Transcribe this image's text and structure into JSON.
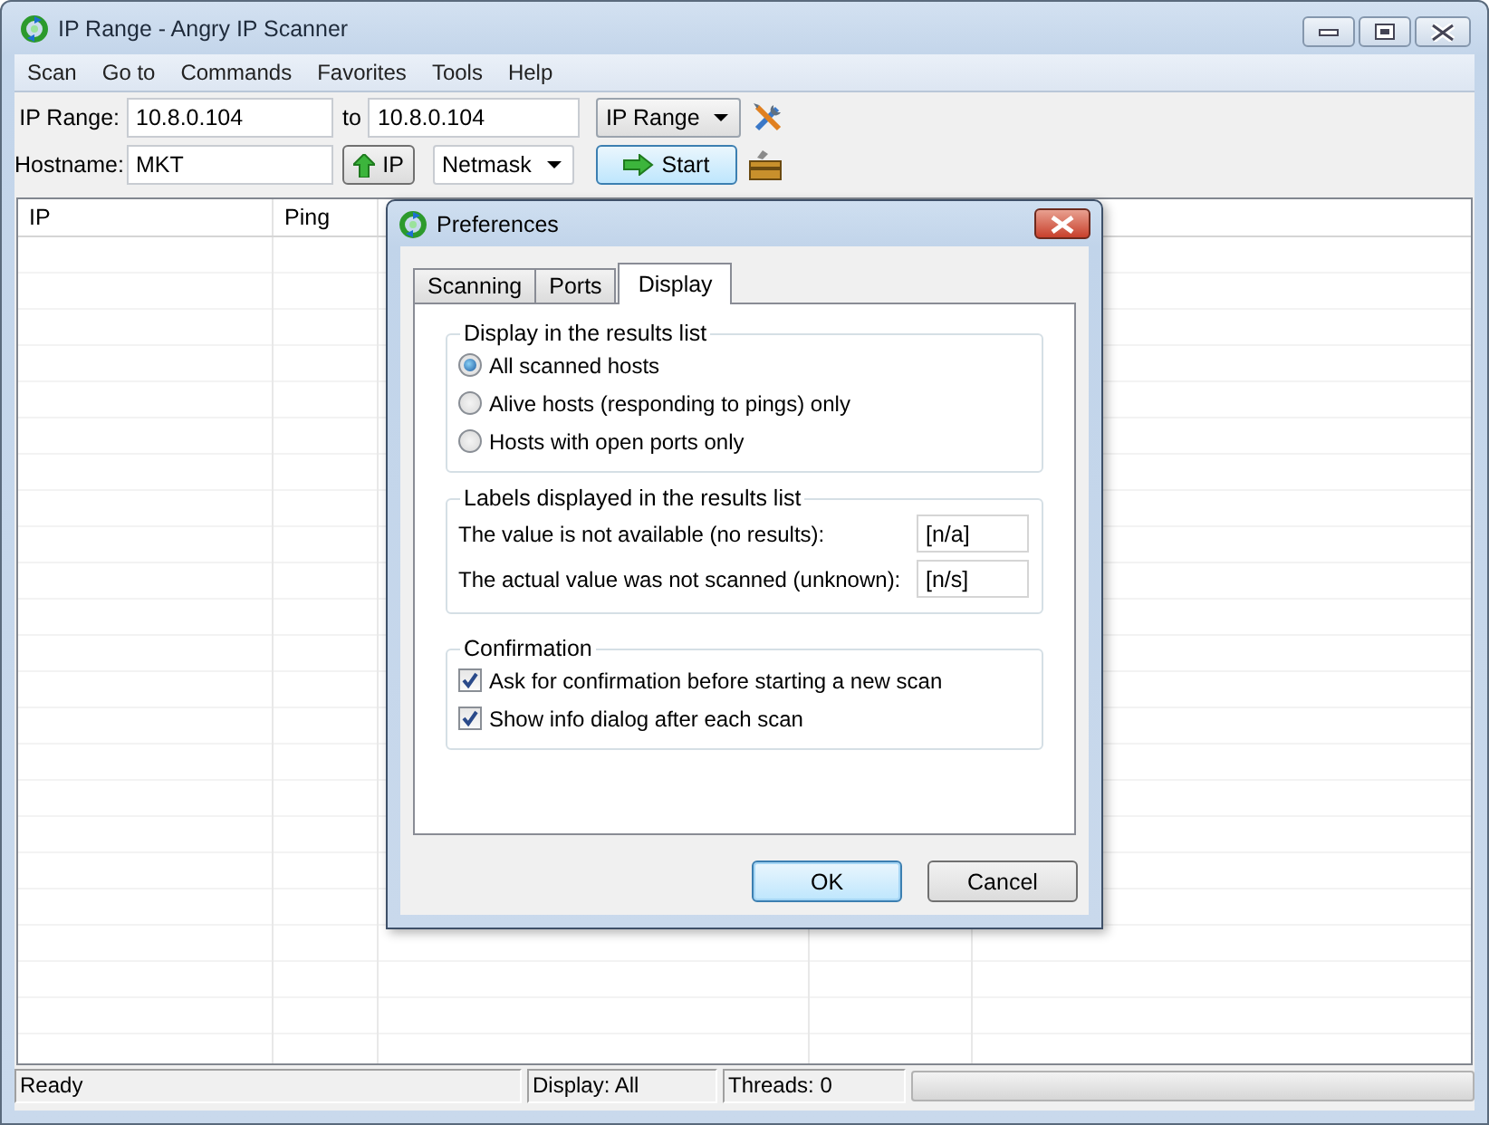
{
  "window": {
    "title": "IP Range - Angry IP Scanner"
  },
  "menu": [
    "Scan",
    "Go to",
    "Commands",
    "Favorites",
    "Tools",
    "Help"
  ],
  "toolbar": {
    "range_label": "IP Range:",
    "range_start": "10.8.0.104",
    "to_label": "to",
    "range_end": "10.8.0.104",
    "feeder": "IP Range",
    "hostname_label": "Hostname:",
    "hostname": "MKT",
    "ip_button": "IP",
    "netmask": "Netmask",
    "start_button": "Start"
  },
  "table": {
    "columns": [
      "IP",
      "Ping"
    ]
  },
  "status_bar": {
    "status": "Ready",
    "display": "Display: All",
    "threads": "Threads: 0",
    "progress": {
      "level": 0
    }
  },
  "dialog": {
    "title": "Preferences",
    "tabs": [
      {
        "label": "Scanning",
        "selected": false
      },
      {
        "label": "Ports",
        "selected": false
      },
      {
        "label": "Display",
        "selected": true
      }
    ],
    "groups": [
      {
        "kind": "radios",
        "title": "Display in the results list",
        "items": [
          {
            "label": "All scanned hosts",
            "selected": true
          },
          {
            "label": "Alive hosts (responding to pings) only",
            "selected": false
          },
          {
            "label": "Hosts with open ports only",
            "selected": false
          }
        ]
      },
      {
        "kind": "fields",
        "title": "Labels displayed in the results list",
        "items": [
          {
            "label": "The value is not available (no results):",
            "value": "[n/a]"
          },
          {
            "label": "The actual value was not scanned (unknown):",
            "value": "[n/s]"
          }
        ]
      },
      {
        "kind": "checks",
        "title": "Confirmation",
        "items": [
          {
            "label": "Ask for confirmation before starting a new scan",
            "checked": true
          },
          {
            "label": "Show info dialog after each scan",
            "checked": true
          }
        ]
      }
    ],
    "buttons": [
      {
        "label": "OK",
        "default": true
      },
      {
        "label": "Cancel",
        "default": false
      }
    ]
  }
}
